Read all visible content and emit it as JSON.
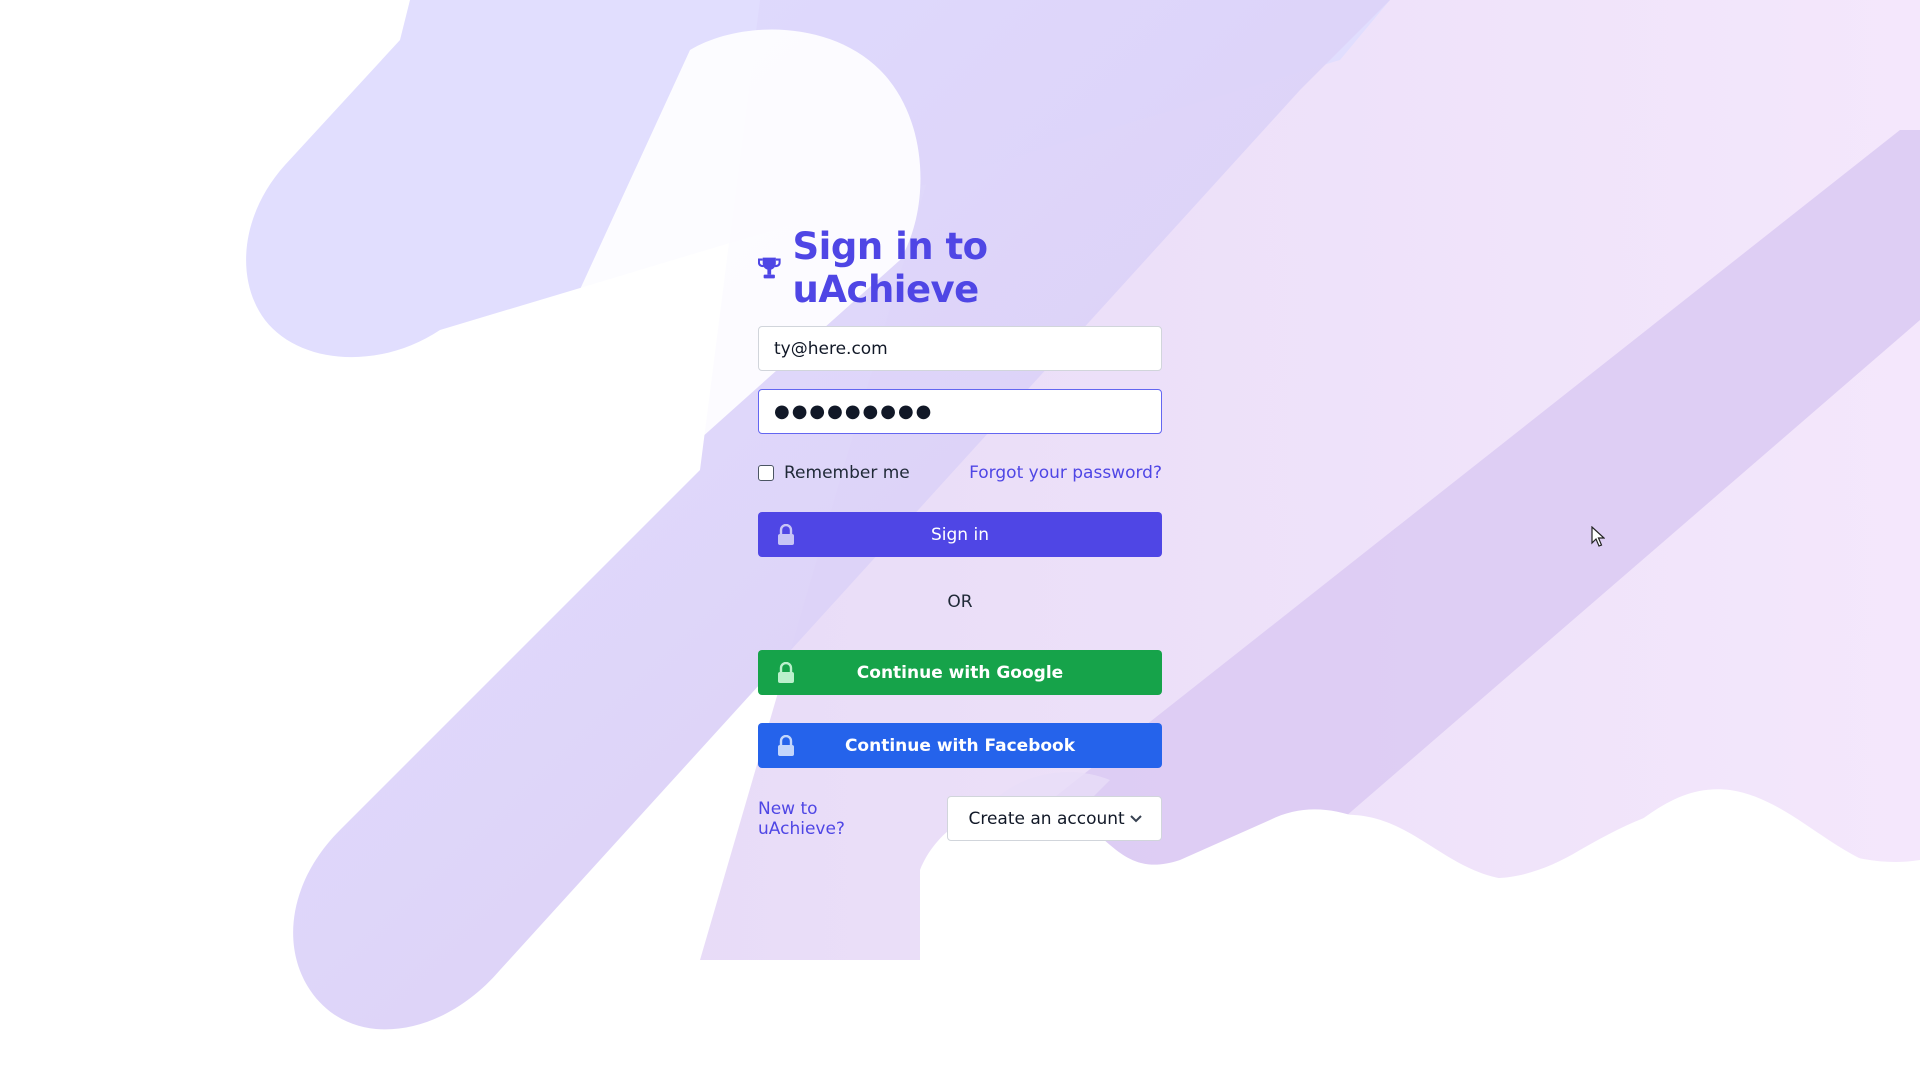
{
  "title": "Sign in to uAchieve",
  "icons": {
    "title_icon": "trophy-icon",
    "button_icon": "lock-icon",
    "dropdown_icon": "chevron-down-icon"
  },
  "form": {
    "email_value": "ty@here.com",
    "password_value": "●●●●●●●●●",
    "remember_label": "Remember me",
    "remember_checked": false,
    "forgot_link": "Forgot your password?",
    "signin_label": "Sign in"
  },
  "divider": "OR",
  "social": {
    "google_label": "Continue with Google",
    "facebook_label": "Continue with Facebook"
  },
  "signup": {
    "prompt_link": "New to uAchieve?",
    "create_label": "Create an account"
  },
  "colors": {
    "accent": "#4f46e5",
    "google": "#16a34a",
    "facebook": "#2563eb"
  }
}
